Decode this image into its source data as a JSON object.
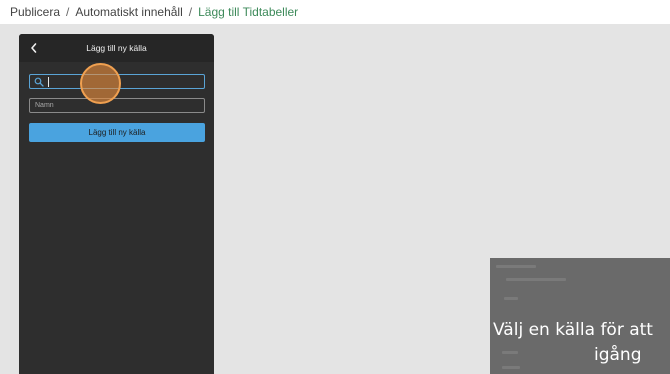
{
  "breadcrumb": {
    "items": [
      "Publicera",
      "Automatiskt innehåll",
      "Lägg till Tidtabeller"
    ],
    "separator": "/"
  },
  "panel": {
    "title": "Lägg till ny källa",
    "search_value": "",
    "name_placeholder": "Namn",
    "add_button_label": "Lägg till ny källa"
  },
  "overlay": {
    "line1": "Välj en källa för att",
    "line2": "igång"
  },
  "icons": {
    "back": "chevron-left-icon",
    "search": "search-icon"
  },
  "colors": {
    "accent": "#4aa3df",
    "breadcrumb_current": "#3d8a5a",
    "panel_bg": "#2e2e2e",
    "click_indicator": "#f0a050"
  }
}
